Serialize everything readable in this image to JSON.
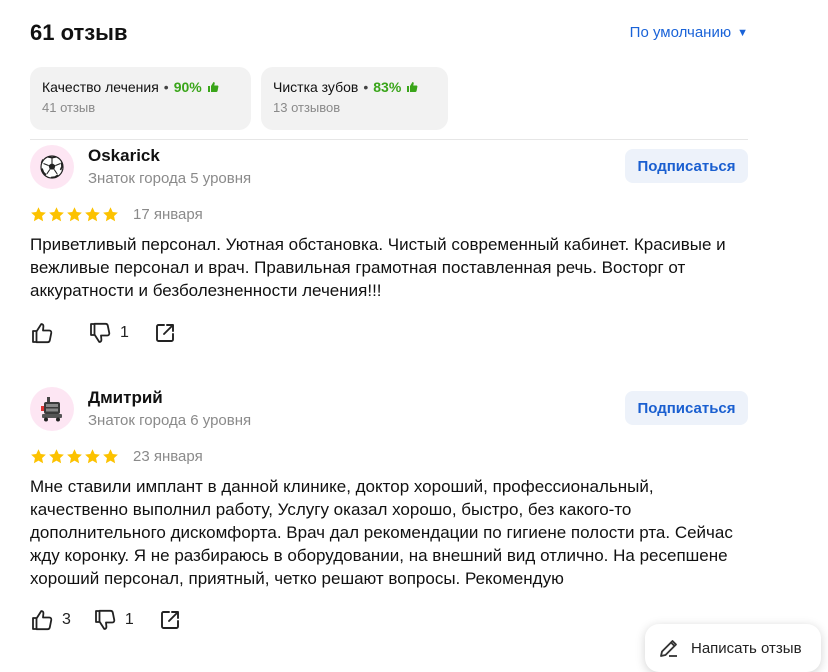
{
  "header": {
    "review_count": "61 отзыв",
    "sort_label": "По умолчанию"
  },
  "aspects": [
    {
      "name": "Качество лечения",
      "percent": "90%",
      "sub": "41 отзыв"
    },
    {
      "name": "Чистка зубов",
      "percent": "83%",
      "sub": "13 отзывов"
    }
  ],
  "reviews": [
    {
      "author": "Oskarick",
      "level": "Знаток города 5 уровня",
      "avatar_icon": "soccer-ball-icon",
      "subscribe_label": "Подписаться",
      "rating": 5,
      "date": "17 января",
      "text": "Приветливый персонал. Уютная обстановка. Чистый современный кабинет. Красивые и вежливые персонал и врач. Правильная грамотная поставленная речь. Восторг от аккуратности и безболезненности лечения!!!",
      "likes": "",
      "dislikes": "1"
    },
    {
      "author": "Дмитрий",
      "level": "Знаток города 6 уровня",
      "avatar_icon": "robot-icon",
      "subscribe_label": "Подписаться",
      "rating": 5,
      "date": "23 января",
      "text": "Мне ставили имплант в данной клинике, доктор хороший, профессиональный, качественно выполнил работу, Услугу оказал хорошо, быстро, без какого-то дополнительного дискомфорта. Врач дал рекомендации по гигиене полости рта. Сейчас жду коронку. Я не разбираюсь в оборудовании, на внешний вид отлично. На ресепшене хороший персонал, приятный, четко решают вопросы. Рекомендую",
      "likes": "3",
      "dislikes": "1"
    }
  ],
  "write_review_label": "Написать отзыв",
  "colors": {
    "accent": "#1a63d8",
    "positive": "#3aa51a",
    "star": "#fcc200",
    "subscribe_bg": "#edf2fa"
  }
}
